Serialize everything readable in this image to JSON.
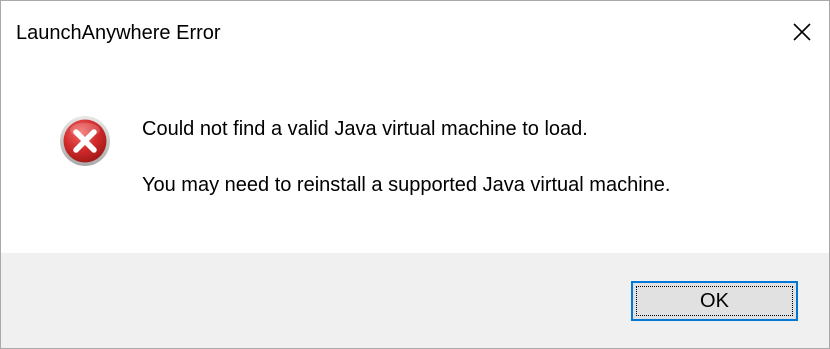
{
  "window": {
    "title": "LaunchAnywhere Error",
    "close_icon": "close-icon"
  },
  "message": {
    "icon": "error-icon",
    "line1": "Could not find a valid Java virtual machine to load.",
    "line2": "You may need to reinstall a supported Java virtual machine."
  },
  "buttons": {
    "ok_label": "OK"
  },
  "colors": {
    "footer_bg": "#f0f0f0",
    "button_border": "#0078d7",
    "button_bg": "#e1e1e1",
    "error_red": "#c8202a"
  }
}
